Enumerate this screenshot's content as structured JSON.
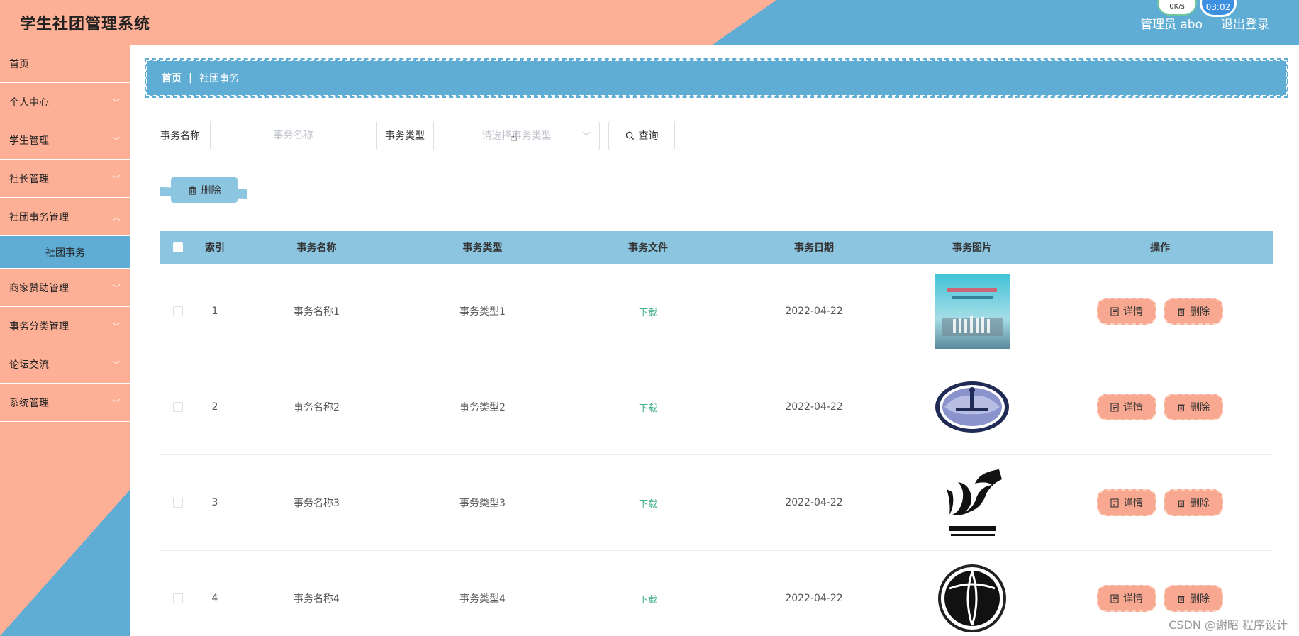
{
  "header": {
    "title": "学生社团管理系统",
    "user_label": "管理员 abo",
    "logout_label": "退出登录",
    "net_speed": "0K/s",
    "clock": "03:02"
  },
  "sidebar": {
    "items": [
      {
        "label": "首页",
        "has_children": false
      },
      {
        "label": "个人中心",
        "has_children": true
      },
      {
        "label": "学生管理",
        "has_children": true
      },
      {
        "label": "社长管理",
        "has_children": true
      },
      {
        "label": "社团事务管理",
        "has_children": true
      },
      {
        "label": "社团事务",
        "active_sub": true
      },
      {
        "label": "商家赞助管理",
        "has_children": true
      },
      {
        "label": "事务分类管理",
        "has_children": true
      },
      {
        "label": "论坛交流",
        "has_children": true
      },
      {
        "label": "系统管理",
        "has_children": true
      }
    ]
  },
  "breadcrumb": {
    "home": "首页",
    "separator": "|",
    "current": "社团事务"
  },
  "search": {
    "name_label": "事务名称",
    "name_placeholder": "事务名称",
    "type_label": "事务类型",
    "type_placeholder": "请选择事务类型",
    "query_label": "查询"
  },
  "toolbar": {
    "delete_label": "删除"
  },
  "table": {
    "columns": [
      "索引",
      "事务名称",
      "事务类型",
      "事务文件",
      "事务日期",
      "事务图片",
      "操作"
    ],
    "rows": [
      {
        "index": "1",
        "name": "事务名称1",
        "type": "事务类型1",
        "file": "下载",
        "date": "2022-04-22",
        "image": "photo-group"
      },
      {
        "index": "2",
        "name": "事务名称2",
        "type": "事务类型2",
        "file": "下载",
        "date": "2022-04-22",
        "image": "emblem-oval"
      },
      {
        "index": "3",
        "name": "事务名称3",
        "type": "事务类型3",
        "file": "下载",
        "date": "2022-04-22",
        "image": "logo-calligraphy"
      },
      {
        "index": "4",
        "name": "事务名称4",
        "type": "事务类型4",
        "file": "下载",
        "date": "2022-04-22",
        "image": "logo-basketball"
      }
    ],
    "detail_label": "详情",
    "delete_label": "删除"
  },
  "watermark": "CSDN @谢昭  程序设计",
  "colors": {
    "salmon": "#fdb095",
    "blue": "#5fadd4",
    "table_header": "#8cc5e0",
    "link_green": "#3fae85"
  }
}
